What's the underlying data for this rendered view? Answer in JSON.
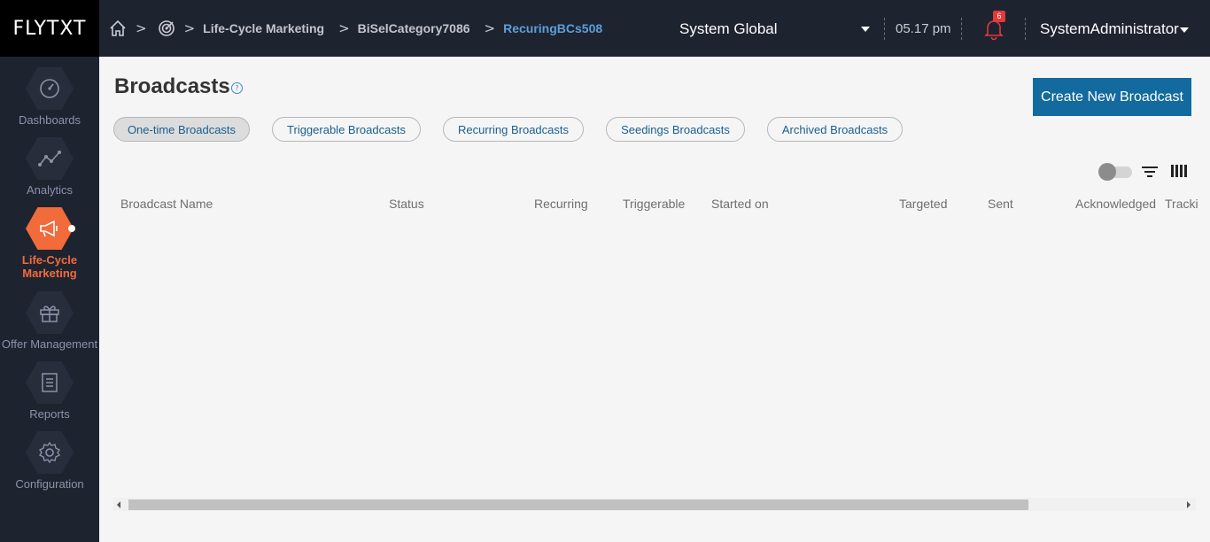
{
  "brand": {
    "logo_text": "FLYTXT"
  },
  "breadcrumb": {
    "items": [
      "Life-Cycle Marketing",
      "BiSelCategory7086"
    ],
    "current": "RecuringBCs508"
  },
  "header": {
    "context": "System Global",
    "time": "05.17 pm",
    "notification_count": "6",
    "user": "SystemAdministrator"
  },
  "sidebar": {
    "items": [
      {
        "label": "Dashboards",
        "icon": "gauge-icon"
      },
      {
        "label": "Analytics",
        "icon": "line-chart-icon"
      },
      {
        "label": "Life-Cycle Marketing",
        "icon": "megaphone-icon",
        "active": true
      },
      {
        "label": "Offer Management",
        "icon": "gift-icon"
      },
      {
        "label": "Reports",
        "icon": "document-icon"
      },
      {
        "label": "Configuration",
        "icon": "gear-icon"
      }
    ]
  },
  "page": {
    "title": "Broadcasts",
    "help": "?",
    "create_button": "Create New Broadcast"
  },
  "tabs": [
    {
      "label": "One-time Broadcasts",
      "selected": true
    },
    {
      "label": "Triggerable Broadcasts"
    },
    {
      "label": "Recurring Broadcasts"
    },
    {
      "label": "Seedings Broadcasts"
    },
    {
      "label": "Archived Broadcasts"
    }
  ],
  "table": {
    "columns": [
      "Broadcast Name",
      "Status",
      "Recurring",
      "Triggerable",
      "Started on",
      "Targeted",
      "Sent",
      "Acknowledged",
      "Tracki"
    ],
    "rows": []
  },
  "colors": {
    "topbar": "#1e2330",
    "accent": "#f26b3a",
    "primary_button": "#136a9e",
    "link": "#5a9fdc"
  }
}
